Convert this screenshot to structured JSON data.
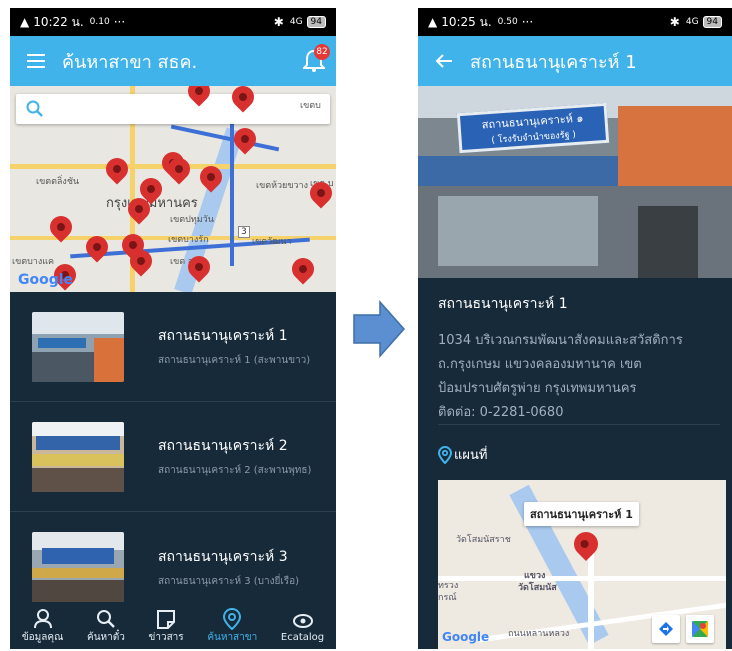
{
  "left": {
    "status": {
      "time": "10:22 น.",
      "speed": "0.10",
      "network": "4G",
      "battery": "94"
    },
    "appbar": {
      "title": "ค้นหาสาขา สธค.",
      "notification_count": "82"
    },
    "map": {
      "districts": [
        "เขตตลิ่งชัน",
        "กรุงเทพมหานคร",
        "เขตห้วยขวาง",
        "เขตบางแค",
        "เขตปทุมวัน",
        "เขตบางรัก",
        "เขตวัฒนา",
        "เขต บ",
        "เขต สา",
        "เขตบ"
      ],
      "road_label": "3",
      "attribution": "Google"
    },
    "branches": [
      {
        "name": "สถานธนานุเคราะห์ 1",
        "subtitle": "สถานธนานุเคราะห์ 1 (สะพานขาว)"
      },
      {
        "name": "สถานธนานุเคราะห์ 2",
        "subtitle": "สถานธนานุเคราะห์ 2 (สะพานพุทธ)"
      },
      {
        "name": "สถานธนานุเคราะห์ 3",
        "subtitle": "สถานธนานุเคราะห์ 3 (บางยี่เรือ)"
      }
    ],
    "tabs": [
      {
        "label": "ข้อมูลคุณ",
        "icon": "person-icon"
      },
      {
        "label": "ค้นหาตั๋ว",
        "icon": "search-icon"
      },
      {
        "label": "ข่าวสาร",
        "icon": "news-icon"
      },
      {
        "label": "ค้นหาสาขา",
        "icon": "location-icon"
      },
      {
        "label": "Ecatalog",
        "icon": "ecatalog-icon"
      }
    ],
    "accent": "#40b3ea"
  },
  "right": {
    "status": {
      "time": "10:25 น.",
      "speed": "0.50",
      "network": "4G",
      "battery": "94"
    },
    "appbar": {
      "title": "สถานธนานุเคราะห์ 1"
    },
    "photo_sign": [
      "สถานธนานุเคราะห์ ๑",
      "( โรงรับจำนำของรัฐ )"
    ],
    "detail": {
      "name": "สถานธนานุเคราะห์ 1",
      "address_lines": [
        "1034 บริเวณกรมพัฒนาสังคมและสวัสดิการ",
        "ถ.กรุงเกษม แขวงคลองมหานาค เขต",
        "ป้อมปราบศัตรูพ่าย กรุงเทพมหานคร",
        "ติดต่อ: 0-2281-0680"
      ]
    },
    "map_section_label": "แผนที่",
    "minimap": {
      "callout": "สถานธนานุเคราะห์ 1",
      "labels": [
        "วัดโสมนัสราช",
        "แขวง",
        "วัดโสมนัส",
        "ทรวง",
        "กรณ์",
        "Google",
        "ถนนหลานหลวง"
      ]
    }
  }
}
